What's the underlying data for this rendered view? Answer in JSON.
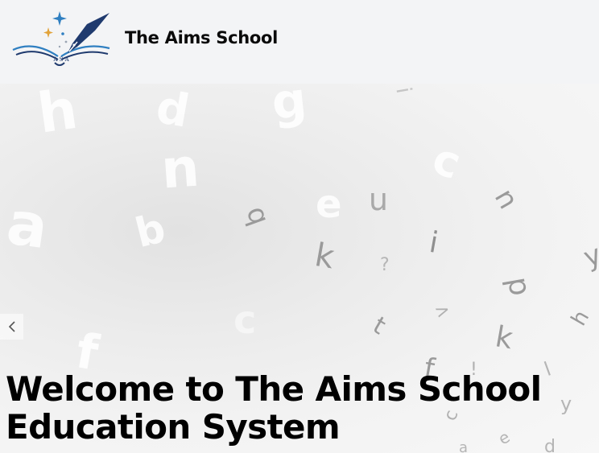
{
  "header": {
    "brand_name": "The Aims School",
    "logo": {
      "icon": "pen-book-logo-icon",
      "monogram": "A S A"
    }
  },
  "hero": {
    "title_line1": "Welcome to The Aims School",
    "title_line2": "Education System",
    "prev_icon": "chevron-left-icon"
  },
  "colors": {
    "header_bg": "#f3f4f6",
    "brand_text": "#0a0a0a",
    "logo_navy": "#1f3a6e",
    "logo_blue": "#2f7fc1",
    "logo_gold": "#e2a33a"
  }
}
